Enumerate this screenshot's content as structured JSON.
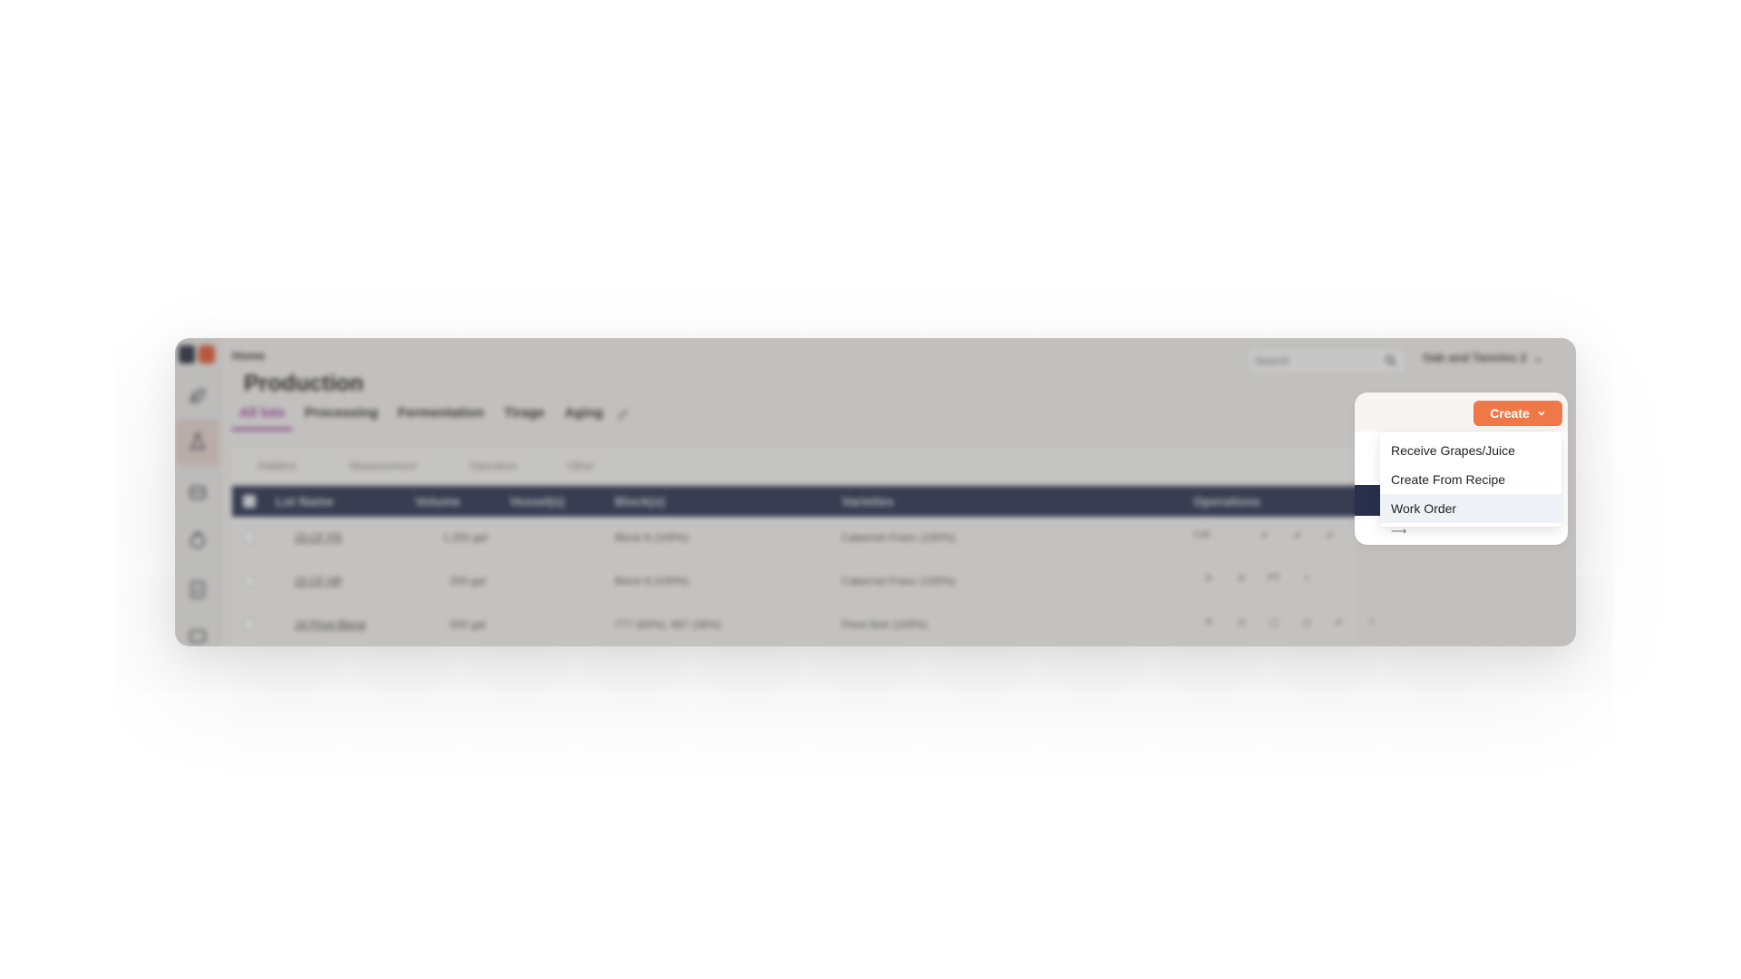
{
  "header": {
    "breadcrumb": "Home",
    "title": "Production",
    "search_placeholder": "Search",
    "account": "Oak and Tannins 2"
  },
  "tabs": [
    {
      "label": "All lots",
      "active": true
    },
    {
      "label": "Processing"
    },
    {
      "label": "Fermentation"
    },
    {
      "label": "Tirage"
    },
    {
      "label": "Aging"
    }
  ],
  "filters": [
    "Additive",
    "Measurement",
    "Operation",
    "Other"
  ],
  "table": {
    "columns": [
      "Lot Name",
      "Volume",
      "Vessel(s)",
      "Block(s)",
      "Varieties",
      "Operations"
    ],
    "rows": [
      {
        "lot": "23 CF FR",
        "volume": "1,250 gal",
        "blocks": "Block 8 (100%)",
        "varieties": "Cabernet Franc (100%)",
        "ops": [
          "CW",
          "✔",
          "✔",
          "✔"
        ]
      },
      {
        "lot": "23 CF HP",
        "volume": "200 gal",
        "blocks": "Block 8 (100%)",
        "varieties": "Cabernet Franc (100%)",
        "ops": [
          "A",
          "A",
          "PT",
          "+"
        ]
      },
      {
        "lot": "24 Pinot Blend",
        "volume": "500 gal",
        "blocks": "777 (64%), 667 (36%)",
        "varieties": "Pinot Noir (100%)",
        "ops": [
          "A",
          "◷",
          "▢",
          "◷",
          "✔",
          "+"
        ]
      }
    ]
  },
  "create_menu": {
    "button_label": "Create",
    "items": [
      "Receive Grapes/Juice",
      "Create From Recipe",
      "Work Order"
    ],
    "highlighted": "Work Order"
  },
  "colors": {
    "accent": "#f07846",
    "tab_active": "#9c3b9b",
    "table_header": "#28304d"
  }
}
